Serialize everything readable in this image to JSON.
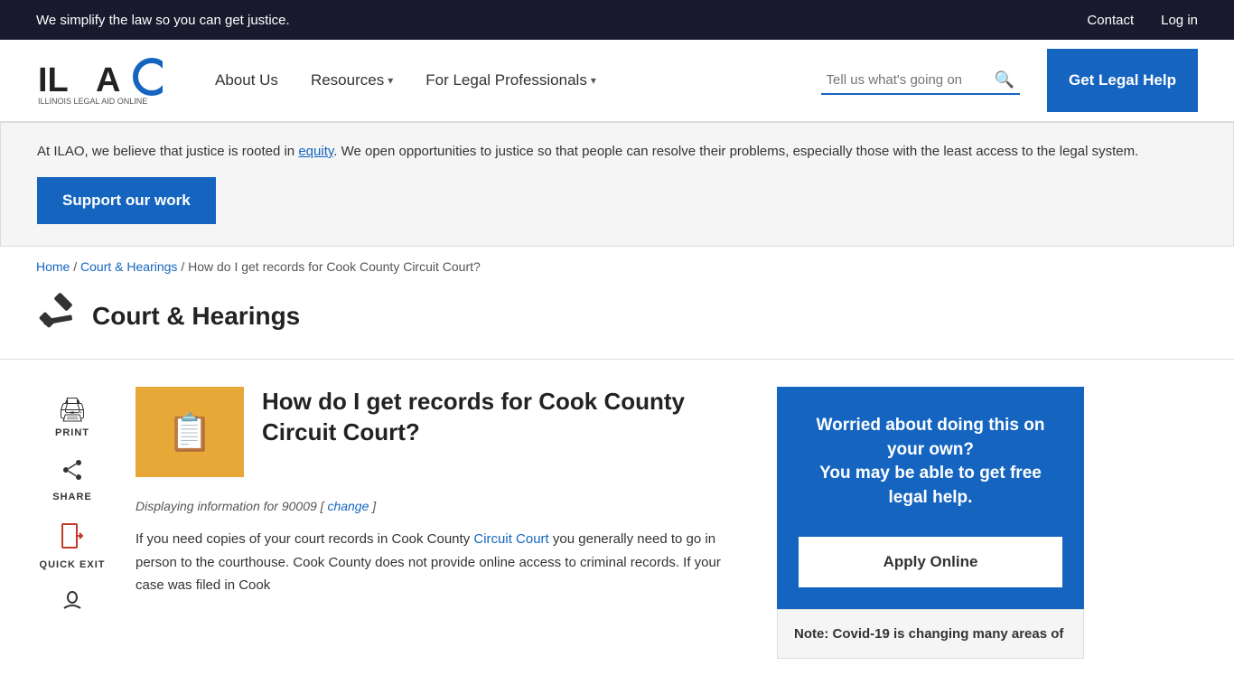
{
  "top_banner": {
    "text": "We simplify the law so you can get justice.",
    "links": [
      {
        "label": "Contact",
        "name": "contact-link"
      },
      {
        "label": "Log in",
        "name": "login-link"
      }
    ]
  },
  "header": {
    "logo_alt": "ILAO - Illinois Legal Aid Online",
    "nav_items": [
      {
        "label": "About Us",
        "has_dropdown": false
      },
      {
        "label": "Resources",
        "has_dropdown": true
      },
      {
        "label": "For Legal Professionals",
        "has_dropdown": true
      }
    ],
    "search_placeholder": "Tell us what's going on",
    "get_legal_help_label": "Get Legal Help"
  },
  "info_banner": {
    "text_before_link": "At ILAO, we believe that justice is rooted in ",
    "link_text": "equity",
    "text_after_link": ". We open opportunities to justice so that people can resolve their problems, especially those with the least access to the legal system.",
    "support_button_label": "Support our work"
  },
  "breadcrumb": {
    "items": [
      {
        "label": "Home",
        "link": true
      },
      {
        "label": "Court & Hearings",
        "link": true
      },
      {
        "label": "How do I get records for Cook County Circuit Court?",
        "link": false
      }
    ],
    "separator": "/"
  },
  "page_title": {
    "icon": "⚖",
    "title": "Court & Hearings"
  },
  "sidebar_actions": [
    {
      "icon": "🖨",
      "label": "PRINT"
    },
    {
      "icon": "↗",
      "label": "SHARE"
    },
    {
      "icon": "🚪",
      "label": "QUICK EXIT"
    },
    {
      "icon": "👁",
      "label": ""
    }
  ],
  "article": {
    "title": "How do I get records for Cook County Circuit Court?",
    "displaying_prefix": "Displaying information for 90009 [",
    "change_link": "change",
    "displaying_suffix": "]",
    "body_before_link": "If you need copies of your court records in Cook County ",
    "body_link": "Circuit Court",
    "body_after_link": " you generally need to go in person to the courthouse. Cook County does not provide online access to criminal records. If your case was filed in Cook"
  },
  "right_panel": {
    "help_card": {
      "title_line1": "Worried about doing this on your own?",
      "title_line2": "You may be able to get free legal help.",
      "apply_button_label": "Apply Online"
    },
    "covid_note": {
      "title": "Note: Covid-19 is changing many areas of"
    }
  }
}
